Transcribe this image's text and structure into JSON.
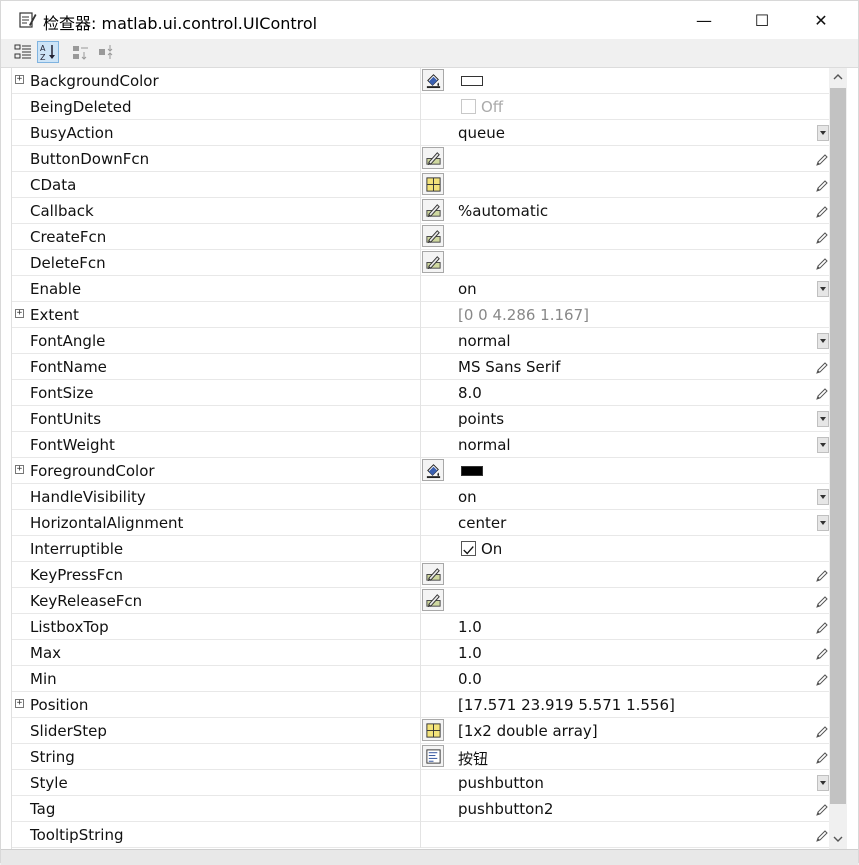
{
  "window": {
    "title": "检查器: matlab.ui.control.UIControl",
    "min_symbol": "—",
    "max_symbol": "☐",
    "close_symbol": "✕"
  },
  "toolbar": {
    "buttons": [
      {
        "name": "categorized-view-button",
        "icon": "categories-icon",
        "active": false
      },
      {
        "name": "sort-alphabetical-button",
        "icon": "sort-az-icon",
        "active": true
      },
      {
        "name": "expand-all-button",
        "icon": "expand-all-icon",
        "active": false
      },
      {
        "name": "collapse-all-button",
        "icon": "collapse-all-icon",
        "active": false
      }
    ]
  },
  "properties": [
    {
      "name": "BackgroundColor",
      "expandable": true,
      "editor": "color",
      "kind": "swatch",
      "swatch_color": "#ffffff"
    },
    {
      "name": "BeingDeleted",
      "kind": "checkbox",
      "checked": false,
      "disabled": true,
      "value": "Off"
    },
    {
      "name": "BusyAction",
      "kind": "combo",
      "value": "queue"
    },
    {
      "name": "ButtonDownFcn",
      "editor": "callback",
      "kind": "edit",
      "value": ""
    },
    {
      "name": "CData",
      "editor": "array",
      "kind": "edit",
      "value": ""
    },
    {
      "name": "Callback",
      "editor": "callback",
      "kind": "edit",
      "value": "%automatic"
    },
    {
      "name": "CreateFcn",
      "editor": "callback",
      "kind": "edit",
      "value": ""
    },
    {
      "name": "DeleteFcn",
      "editor": "callback",
      "kind": "edit",
      "value": ""
    },
    {
      "name": "Enable",
      "kind": "combo",
      "value": "on"
    },
    {
      "name": "Extent",
      "expandable": true,
      "kind": "readonly",
      "value": "[0 0 4.286 1.167]"
    },
    {
      "name": "FontAngle",
      "kind": "combo",
      "value": "normal"
    },
    {
      "name": "FontName",
      "kind": "edit",
      "value": "MS Sans Serif"
    },
    {
      "name": "FontSize",
      "kind": "edit",
      "value": "8.0"
    },
    {
      "name": "FontUnits",
      "kind": "combo",
      "value": "points"
    },
    {
      "name": "FontWeight",
      "kind": "combo",
      "value": "normal"
    },
    {
      "name": "ForegroundColor",
      "expandable": true,
      "editor": "color",
      "kind": "swatch",
      "swatch_color": "#000000"
    },
    {
      "name": "HandleVisibility",
      "kind": "combo",
      "value": "on"
    },
    {
      "name": "HorizontalAlignment",
      "kind": "combo",
      "value": "center"
    },
    {
      "name": "Interruptible",
      "kind": "checkbox",
      "checked": true,
      "disabled": false,
      "value": "On"
    },
    {
      "name": "KeyPressFcn",
      "editor": "callback",
      "kind": "edit",
      "value": ""
    },
    {
      "name": "KeyReleaseFcn",
      "editor": "callback",
      "kind": "edit",
      "value": ""
    },
    {
      "name": "ListboxTop",
      "kind": "edit",
      "value": "1.0"
    },
    {
      "name": "Max",
      "kind": "edit",
      "value": "1.0"
    },
    {
      "name": "Min",
      "kind": "edit",
      "value": "0.0"
    },
    {
      "name": "Position",
      "expandable": true,
      "kind": "text",
      "value": "[17.571 23.919 5.571 1.556]"
    },
    {
      "name": "SliderStep",
      "editor": "array",
      "kind": "edit",
      "value": "[1x2  double array]"
    },
    {
      "name": "String",
      "editor": "text",
      "kind": "edit",
      "value": "按钮"
    },
    {
      "name": "Style",
      "kind": "combo",
      "value": "pushbutton"
    },
    {
      "name": "Tag",
      "kind": "edit",
      "value": "pushbutton2"
    },
    {
      "name": "TooltipString",
      "kind": "edit",
      "value": ""
    }
  ]
}
